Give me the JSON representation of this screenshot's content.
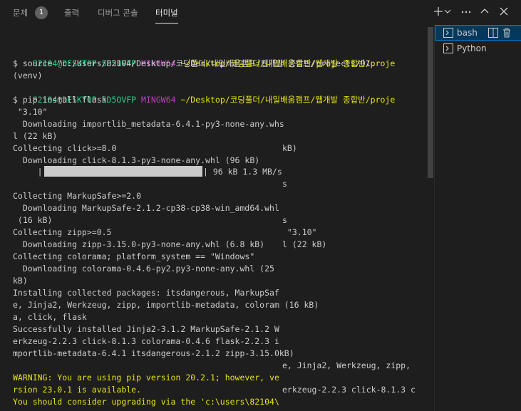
{
  "tabs": {
    "problems": "문제",
    "problems_count": "1",
    "output": "출력",
    "debug_console": "디버그 콘솔",
    "terminal": "터미널"
  },
  "toolbar": {
    "new_terminal": "+"
  },
  "terminals": [
    {
      "name": "bash",
      "icon": "terminal-icon"
    },
    {
      "name": "Python",
      "icon": "terminal-icon"
    }
  ],
  "terminal_lines": {
    "l1_user": "82104@DESKTOP-5D5OVFP",
    "l1_shell": "MINGW64",
    "l1_path": "~/Desktop/코딩풀더/내일배움캠프/웹개발 종합반/proje",
    "l2": "$ source \"c:/Users/82104/Desktop/코딩풀더/내일배움캠프/웹개발 종합반/projects/01.",
    "l3": "(venv)",
    "l4_user": "82104@DESKTOP-5D5OVFP",
    "l4_shell": "MINGW64",
    "l4_path": "~/Desktop/코딩풀더/내일배움캠프/웹개발 종합반/proje",
    "l5": "$ pip install flask",
    "l6": " \"3.10\"",
    "l7": "  Downloading importlib_metadata-6.4.1-py3-none-any.whs",
    "l8": "l (22 kB)",
    "l9": "Collecting click>=8.0",
    "l9b": "kB)",
    "l10": "  Downloading click-8.1.3-py3-none-any.whl (96 kB)",
    "l11a": "     |",
    "l11b": "| 96 kB 1.3 MB/s",
    "l12": "s",
    "l13": "Collecting MarkupSafe>=2.0",
    "l14": "  Downloading MarkupSafe-2.1.2-cp38-cp38-win_amd64.whl",
    "l15a": " (16 kB)",
    "l15b": "s",
    "l16a": "Collecting zipp>=0.5",
    "l16b": " \"3.10\"",
    "l17a": "  Downloading zipp-3.15.0-py3-none-any.whl (6.8 kB)",
    "l17b": "l (22 kB)",
    "l18": "Collecting colorama; platform_system == \"Windows\"",
    "l19": "  Downloading colorama-0.4.6-py2.py3-none-any.whl (25",
    "l20": "kB)",
    "l21": "Installing collected packages: itsdangerous, MarkupSaf",
    "l22": "e, Jinja2, Werkzeug, zipp, importlib-metadata, coloram (16 kB)",
    "l23": "a, click, flask",
    "l24": "Successfully installed Jinja2-3.1.2 MarkupSafe-2.1.2 W",
    "l25": "erkzeug-2.2.3 click-8.1.3 colorama-0.4.6 flask-2.2.3 i",
    "l26": "mportlib-metadata-6.4.1 itsdangerous-2.1.2 zipp-3.15.0kB)",
    "l27": "e, Jinja2, Werkzeug, zipp,",
    "l28": "WARNING: You are using pip version 20.2.1; however, ve",
    "l29a": "rsion 23.0.1 is available.",
    "l29b": "erkzeug-2.2.3 click-8.1.3 c",
    "l30": "You should consider upgrading via the 'c:\\users\\82104\\"
  },
  "progress_bar_fraction": 1.0,
  "colors": {
    "background": "#1e1e1e",
    "text": "#cccccc",
    "user_host": "#23d18b",
    "shell": "#bc3fbc",
    "path": "#e5e510",
    "warning": "#e5e510",
    "active_entry": "#04395e",
    "focus_border": "#007fd4"
  }
}
